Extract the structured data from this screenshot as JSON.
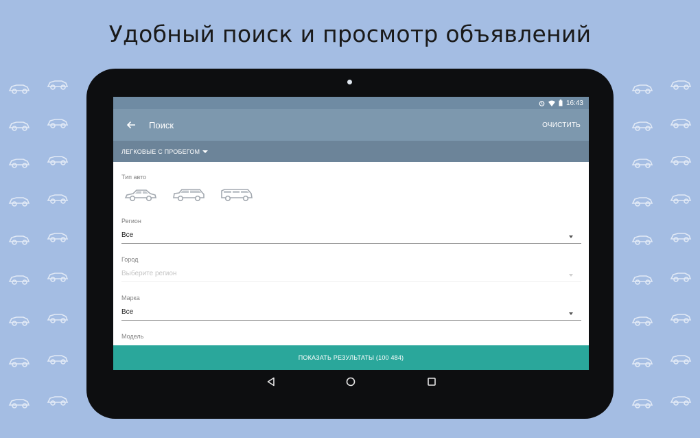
{
  "promo_title": "Удобный поиск и просмотр объявлений",
  "status": {
    "time": "16:43"
  },
  "appbar": {
    "title": "Поиск",
    "clear_label": "ОЧИСТИТЬ"
  },
  "category": {
    "label": "ЛЕГКОВЫЕ С ПРОБЕГОМ"
  },
  "form": {
    "car_type_label": "Тип авто",
    "car_types": [
      "sedan-icon",
      "suv-icon",
      "minivan-icon"
    ],
    "region": {
      "label": "Регион",
      "value": "Все"
    },
    "city": {
      "label": "Город",
      "placeholder": "Выберите регион"
    },
    "brand": {
      "label": "Марка",
      "value": "Все"
    },
    "model": {
      "label": "Модель"
    }
  },
  "show_button": "ПОКАЗАТЬ РЕЗУЛЬТАТЫ (100 484)",
  "colors": {
    "background": "#a4bde3",
    "appbar": "#7d98ae",
    "accent": "#2aa79b"
  }
}
